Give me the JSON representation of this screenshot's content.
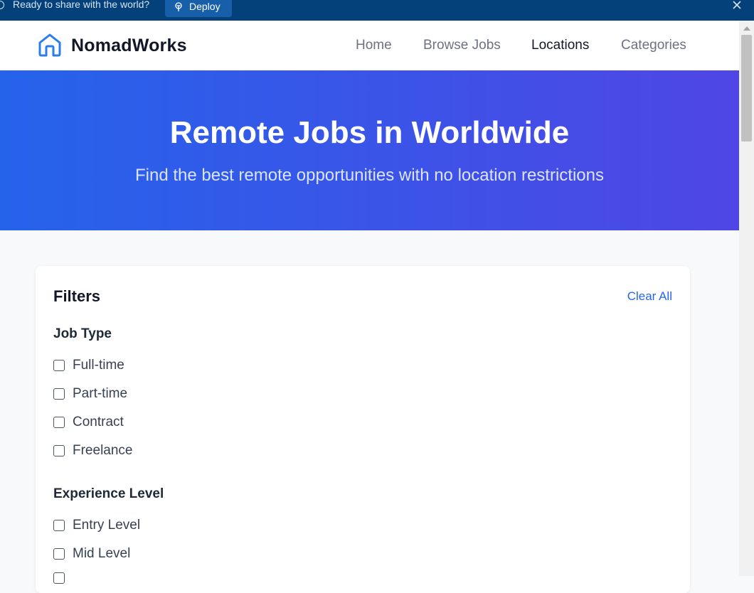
{
  "banner": {
    "message": "Ready to share with the world?",
    "deploy_label": "Deploy"
  },
  "navbar": {
    "brand": "NomadWorks",
    "links": [
      {
        "label": "Home",
        "active": false
      },
      {
        "label": "Browse Jobs",
        "active": false
      },
      {
        "label": "Locations",
        "active": true
      },
      {
        "label": "Categories",
        "active": false
      }
    ]
  },
  "hero": {
    "title": "Remote Jobs in Worldwide",
    "subtitle": "Find the best remote opportunities with no location restrictions"
  },
  "filters": {
    "title": "Filters",
    "clear_label": "Clear All",
    "job_type": {
      "title": "Job Type",
      "options": [
        "Full-time",
        "Part-time",
        "Contract",
        "Freelance"
      ]
    },
    "experience": {
      "title": "Experience Level",
      "options": [
        "Entry Level",
        "Mid Level"
      ]
    }
  },
  "colors": {
    "accent": "#2563eb",
    "hero_start": "#2563eb",
    "hero_end": "#4f46e5",
    "banner_bg": "#04407a"
  }
}
